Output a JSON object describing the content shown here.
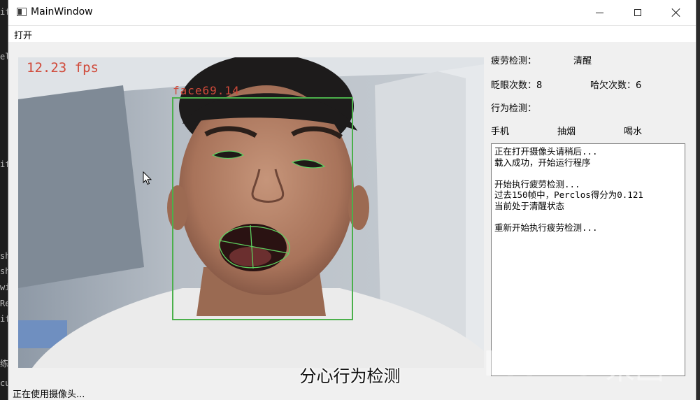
{
  "window": {
    "title": "MainWindow"
  },
  "menu": {
    "open_label": "打开"
  },
  "video": {
    "fps_text": "12.23 fps",
    "face_label": "face69.14"
  },
  "panel": {
    "fatigue_label": "疲劳检测：",
    "fatigue_value": "清醒",
    "blink_text": "眨眼次数：8",
    "yawn_text": "哈欠次数：6",
    "behavior_label": "行为检测：",
    "behaviors": [
      "手机",
      "抽烟",
      "喝水"
    ]
  },
  "log": {
    "lines": [
      "正在打开摄像头请稍后...",
      "载入成功，开始运行程序",
      "",
      "开始执行疲劳检测...",
      "过去150帧中，Perclos得分为0.121",
      "当前处于清醒状态",
      "",
      "重新开始执行疲劳检测..."
    ]
  },
  "status": {
    "text": "正在使用摄像头..."
  },
  "caption": "分心行为检测",
  "watermark": {
    "latin": "LAPIC",
    "cjk": "来画"
  },
  "terminal": {
    "fragments": [
      "if",
      "el",
      "if",
      "sh",
      "sh",
      "wi",
      "Re",
      "if",
      "练",
      "cu"
    ]
  },
  "colors": {
    "detection_box": "#4bb04b",
    "overlay_text": "#d04a3a",
    "window_bg": "#f0f0f0"
  }
}
